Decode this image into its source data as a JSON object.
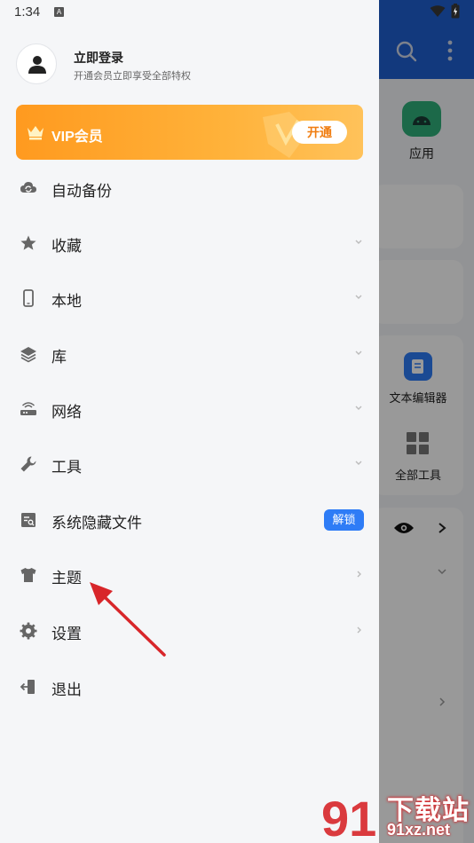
{
  "status": {
    "time": "1:34",
    "notif_letter": "A"
  },
  "profile": {
    "title": "立即登录",
    "subtitle": "开通会员立即享受全部特权"
  },
  "vip": {
    "label": "VIP会员",
    "button": "开通"
  },
  "menu": [
    {
      "label": "自动备份",
      "icon": "cloud-sync-icon",
      "chevron": "none"
    },
    {
      "label": "收藏",
      "icon": "star-icon",
      "chevron": "down"
    },
    {
      "label": "本地",
      "icon": "phone-icon",
      "chevron": "down"
    },
    {
      "label": "库",
      "icon": "layers-icon",
      "chevron": "down"
    },
    {
      "label": "网络",
      "icon": "router-icon",
      "chevron": "down"
    },
    {
      "label": "工具",
      "icon": "wrench-icon",
      "chevron": "down"
    },
    {
      "label": "系统隐藏文件",
      "icon": "hidden-file-icon",
      "chevron": "none",
      "badge": "解锁"
    },
    {
      "label": "主题",
      "icon": "tshirt-icon",
      "chevron": "right"
    },
    {
      "label": "设置",
      "icon": "gear-icon",
      "chevron": "right"
    },
    {
      "label": "退出",
      "icon": "exit-icon",
      "chevron": "none"
    }
  ],
  "background_app": {
    "apps_label": "应用",
    "text_editor_label": "文本编辑器",
    "all_tools_label": "全部工具"
  },
  "watermark": {
    "brand": "下载站",
    "url": "91xz.net"
  },
  "colors": {
    "accent": "#2e7cf6",
    "topbar": "#1f5fd0",
    "vip_orange": "#ff9a1f",
    "arrow": "#d8262a"
  }
}
